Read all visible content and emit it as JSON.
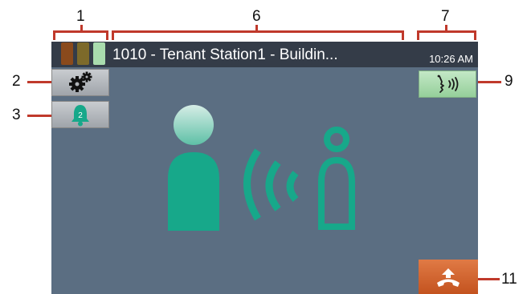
{
  "callouts": {
    "n1": "1",
    "n2": "2",
    "n3": "3",
    "n6": "6",
    "n7": "7",
    "n9": "9",
    "n11": "11"
  },
  "status_bar": {
    "title": "1010 - Tenant Station1 - Buildin...",
    "time": "10:26 AM",
    "signal_colors": [
      "#8a4a1c",
      "#7d6a2a",
      "#a9dcae"
    ]
  },
  "side_buttons": {
    "settings_icon": "gears-icon",
    "notifications_icon": "bell-icon",
    "notification_count": "2"
  },
  "talk_button": {
    "icon": "speaking-head-icon"
  },
  "end_button": {
    "icon": "hang-up-icon"
  },
  "main_illustration": {
    "icon": "person-talking-to-station-icon"
  },
  "colors": {
    "screen_bg": "#5b6e82",
    "status_bar_bg": "#343c48",
    "accent_teal": "#1aa98a",
    "callout_line": "#c0392b",
    "end_call": "#d2642c",
    "talk_green": "#a9dcae"
  }
}
